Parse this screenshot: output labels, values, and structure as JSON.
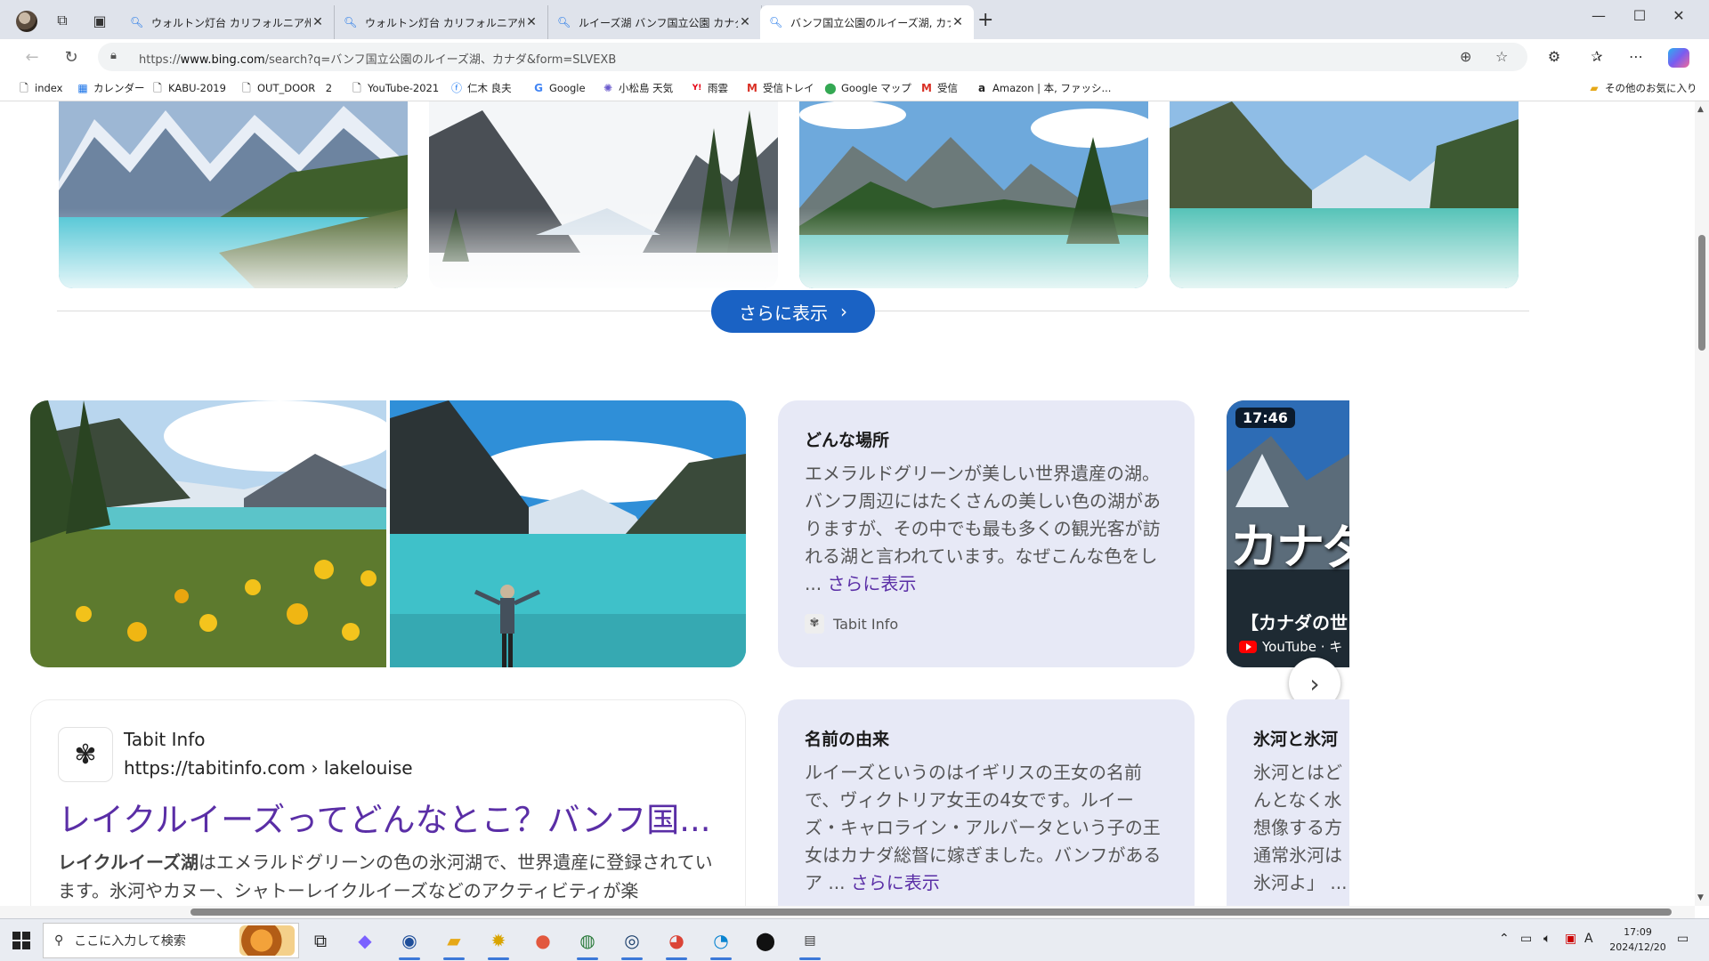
{
  "browser": {
    "tabs": [
      {
        "title": "ウォルトン灯台 カリフォルニア州 - 検索",
        "active": false
      },
      {
        "title": "ウォルトン灯台 カリフォルニア州 - 検索",
        "active": false
      },
      {
        "title": "ルイーズ湖 バンフ国立公園 カナダ - 検索",
        "active": false
      },
      {
        "title": "バンフ国立公園のルイーズ湖, カナダ - 検索",
        "active": true
      }
    ],
    "url_prefix": "https://",
    "url_domain": "www.bing.com",
    "url_rest": "/search?q=バンフ国立公園のルイーズ湖、カナダ&form=SLVEXB",
    "bookmarks": [
      {
        "label": "index",
        "icon": "page-icon"
      },
      {
        "label": "カレンダー",
        "icon": "calendar-icon"
      },
      {
        "label": "KABU-2019",
        "icon": "page-icon"
      },
      {
        "label": "OUT_DOOR　2",
        "icon": "page-icon"
      },
      {
        "label": "YouTube-2021",
        "icon": "page-icon"
      },
      {
        "label": "仁木 良夫",
        "icon": "facebook-icon"
      },
      {
        "label": "Google",
        "icon": "google-icon"
      },
      {
        "label": "小松島 天気",
        "icon": "weather-icon"
      },
      {
        "label": "雨雲",
        "icon": "yahoo-icon"
      },
      {
        "label": "受信トレイ",
        "icon": "gmail-icon"
      },
      {
        "label": "Google マップ",
        "icon": "maps-icon"
      },
      {
        "label": "受信",
        "icon": "gmail-icon"
      },
      {
        "label": "Amazon | 本, ファッシ...",
        "icon": "amazon-icon"
      }
    ],
    "other_favorites": "その他のお気に入り"
  },
  "page": {
    "show_more": "さらに表示",
    "info_cards": [
      {
        "title": "どんな場所",
        "body": "エメラルドグリーンが美しい世界遺産の湖。バンフ周辺にはたくさんの美しい色の湖がありますが、その中でも最も多くの観光客が訪れる湖と言われています。なぜこんな色をし ... ",
        "more": "さらに表示",
        "source": "Tabit Info"
      },
      {
        "title": "名前の由来",
        "body": "ルイーズというのはイギリスの王女の名前で、ヴィクトリア女王の4女です。ルイーズ・キャロライン・アルバータという子の王女はカナダ総督に嫁ぎました。バンフがあるア ... ",
        "more": "さらに表示"
      }
    ],
    "video": {
      "duration": "17:46",
      "overlay": "カナダ",
      "title": "【カナダの世",
      "source": "YouTube · キ"
    },
    "partial_card": {
      "title": "氷河と氷河",
      "lines": [
        "氷河とはど",
        "んとなく水",
        "想像する方",
        "通常氷河は",
        "氷河よ」 ..."
      ]
    },
    "result": {
      "site_name": "Tabit Info",
      "site_url": "https://tabitinfo.com › lakelouise",
      "title": "レイクルイーズってどんなとこ？バンフ国...",
      "snippet_bold": "レイクルイーズ湖",
      "snippet": "はエメラルドグリーンの色の氷河湖で、世界遺産に登録されています。氷河やカヌー、シャトーレイクルイーズなどのアクティビティが楽"
    }
  },
  "taskbar": {
    "search_placeholder": "ここに入力して検索",
    "time": "17:09",
    "date": "2024/12/20",
    "ime": "A"
  }
}
